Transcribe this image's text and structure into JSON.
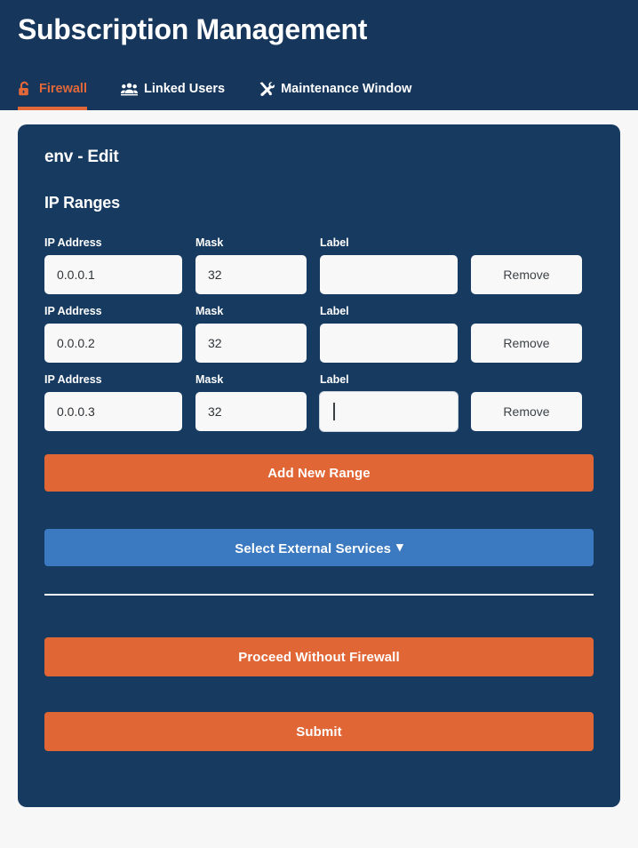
{
  "header": {
    "title": "Subscription Management",
    "tabs": [
      {
        "label": "Firewall",
        "icon": "unlock-icon",
        "active": true
      },
      {
        "label": "Linked Users",
        "icon": "users-icon",
        "active": false
      },
      {
        "label": "Maintenance Window",
        "icon": "tools-icon",
        "active": false
      }
    ]
  },
  "card": {
    "title": "env - Edit",
    "section_title": "IP Ranges",
    "columns": {
      "ip": "IP Address",
      "mask": "Mask",
      "label": "Label"
    },
    "rows": [
      {
        "ip": "0.0.0.1",
        "mask": "32",
        "label": "",
        "remove_label": "Remove",
        "focused_field": null
      },
      {
        "ip": "0.0.0.2",
        "mask": "32",
        "label": "",
        "remove_label": "Remove",
        "focused_field": null
      },
      {
        "ip": "0.0.0.3",
        "mask": "32",
        "label": "",
        "remove_label": "Remove",
        "focused_field": "label"
      }
    ],
    "add_range_label": "Add New Range",
    "select_services_label": "Select External Services",
    "select_services_caret": "▾",
    "proceed_label": "Proceed Without Firewall",
    "submit_label": "Submit"
  },
  "colors": {
    "header_bg": "#16365c",
    "card_bg": "#163a60",
    "page_bg": "#f7f7f8",
    "accent_orange": "#e06635",
    "accent_blue": "#3b7ac0",
    "input_bg": "#f8f8f8",
    "text_light": "#ffffff"
  }
}
